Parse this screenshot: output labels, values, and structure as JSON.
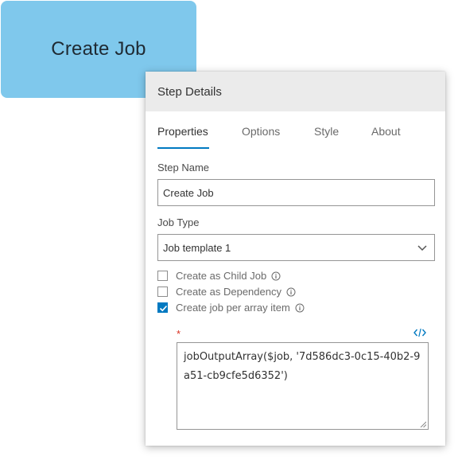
{
  "job_node": {
    "label": "Create Job"
  },
  "panel": {
    "title": "Step Details",
    "tabs": [
      {
        "label": "Properties",
        "active": true
      },
      {
        "label": "Options",
        "active": false
      },
      {
        "label": "Style",
        "active": false
      },
      {
        "label": "About",
        "active": false
      }
    ],
    "step_name": {
      "label": "Step Name",
      "value": "Create Job"
    },
    "job_type": {
      "label": "Job Type",
      "value": "Job template 1"
    },
    "checkboxes": [
      {
        "label": "Create as Child Job",
        "checked": false
      },
      {
        "label": "Create as Dependency",
        "checked": false
      },
      {
        "label": "Create job per array item",
        "checked": true
      }
    ],
    "array_field": {
      "required_mark": "*",
      "value": "jobOutputArray($job, '7d586dc3-0c15-40b2-9a51-cb9cfe5d6352')"
    }
  },
  "colors": {
    "job_node": "#7fc8ec",
    "accent": "#0079c1",
    "header_bg": "#ebebeb",
    "required": "#d83020"
  },
  "icons": [
    "info-icon",
    "chevron-down-icon",
    "code-icon",
    "checkmark-icon",
    "resize-grip-icon"
  ]
}
